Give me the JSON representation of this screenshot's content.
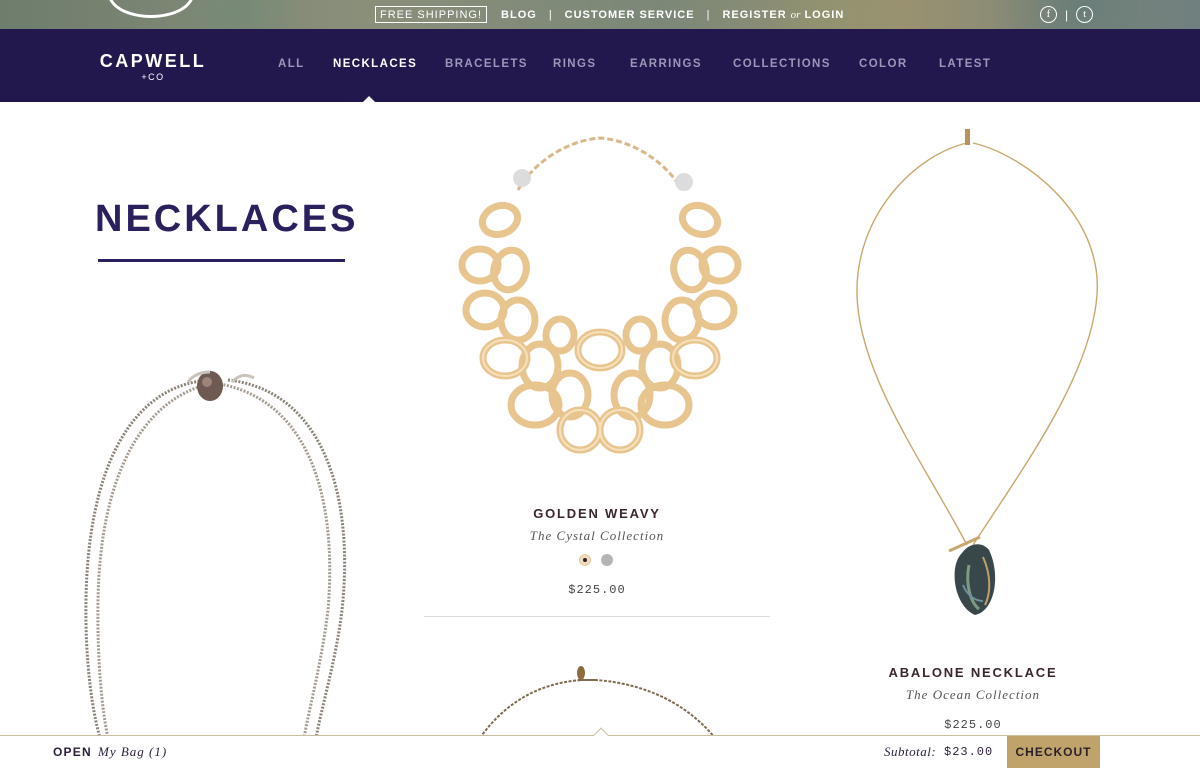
{
  "topbar": {
    "free_shipping": "FREE SHIPPING!",
    "blog": "BLOG",
    "sep1": "|",
    "customer_service": "CUSTOMER SERVICE",
    "sep2": "|",
    "register": "REGISTER",
    "or": "or",
    "login": "LOGIN",
    "social": {
      "facebook_glyph": "f",
      "sep": "|",
      "twitter_glyph": "t"
    }
  },
  "brand": {
    "name": "CAPWELL",
    "sub": "+CO"
  },
  "nav": {
    "items": [
      {
        "label": "ALL"
      },
      {
        "label": "NECKLACES"
      },
      {
        "label": "BRACELETS"
      },
      {
        "label": "RINGS"
      },
      {
        "label": "EARRINGS"
      },
      {
        "label": "COLLECTIONS"
      },
      {
        "label": "COLOR"
      },
      {
        "label": "LATEST"
      }
    ],
    "active": "NECKLACES"
  },
  "page": {
    "title": "NECKLACES"
  },
  "products": [
    {
      "name": "GOLDEN WEAVY",
      "collection": "The Cystal Collection",
      "price": "$225.00",
      "swatches": [
        "gold",
        "silver"
      ],
      "selected_swatch": "gold"
    },
    {
      "name": "ABALONE NECKLACE",
      "collection": "The Ocean Collection",
      "price": "$225.00"
    }
  ],
  "bag": {
    "open_label": "OPEN",
    "bag_label": "My Bag (1)",
    "subtotal_label": "Subtotal:",
    "subtotal_value": "$23.00",
    "checkout_label": "CHECKOUT"
  },
  "colors": {
    "nav_bg": "#22184e",
    "title": "#2b1f5e",
    "checkout_bg": "#bfa36a",
    "gold": "#e8c48e",
    "silver": "#b5b5b5"
  }
}
